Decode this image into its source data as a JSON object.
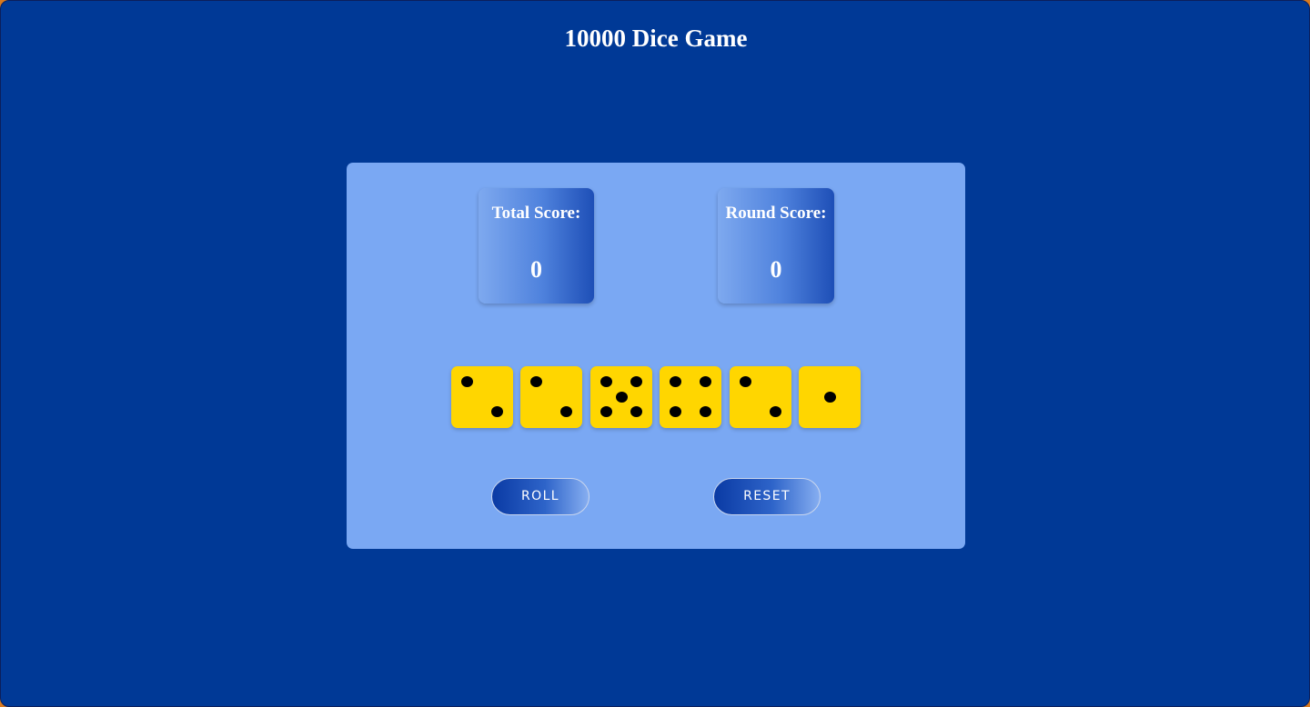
{
  "header": {
    "title": "10000 Dice Game"
  },
  "scores": {
    "total": {
      "label": "Total Score:",
      "value": "0"
    },
    "round": {
      "label": "Round Score:",
      "value": "0"
    }
  },
  "dice": [
    2,
    2,
    5,
    4,
    2,
    1
  ],
  "buttons": {
    "roll": "ROLL",
    "reset": "RESET"
  },
  "colors": {
    "background": "#003996",
    "board": "#7aa8f3",
    "die": "#ffd600",
    "pip": "#000000",
    "text": "#ffffff"
  }
}
